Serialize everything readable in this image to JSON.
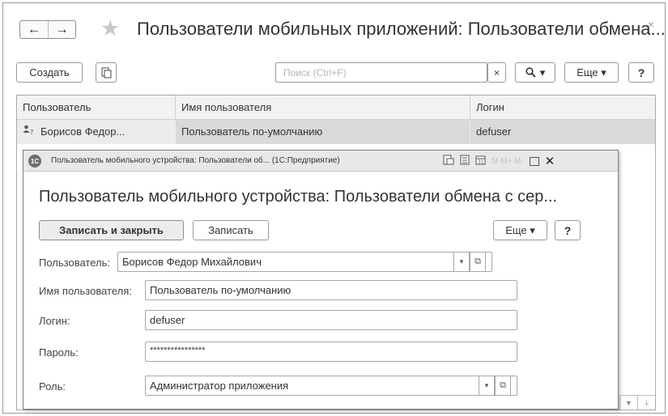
{
  "window": {
    "title": "Пользователи мобильных приложений: Пользователи обмена...",
    "close_glyph": "×"
  },
  "nav": {
    "back_glyph": "←",
    "forward_glyph": "→",
    "favorite_glyph": "★"
  },
  "toolbar": {
    "create_label": "Создать",
    "search_placeholder": "Поиск (Ctrl+F)",
    "clear_glyph": "×",
    "find_glyph": "🔍 ▾",
    "more_label": "Еще ▾",
    "help_label": "?"
  },
  "table": {
    "columns": [
      "Пользователь",
      "Имя пользователя",
      "Логин"
    ],
    "rows": [
      {
        "user": "Борисов Федор...",
        "name": "Пользователь по-умолчанию",
        "login": "defuser"
      }
    ]
  },
  "dialog": {
    "window_title": "Пользователь мобильного устройства: Пользователи об... (1С:Предприятие)",
    "logo_text": "1С",
    "toolbar_dim": "M  M+  M-",
    "heading": "Пользователь мобильного устройства: Пользователи обмена с сер...",
    "save_close_label": "Записать и закрыть",
    "save_label": "Записать",
    "more_label": "Еще ▾",
    "help_label": "?",
    "fields": {
      "user": {
        "label": "Пользователь:",
        "value": "Борисов Федор Михайлович"
      },
      "name": {
        "label": "Имя пользователя:",
        "value": "Пользователь по-умолчанию"
      },
      "login": {
        "label": "Логин:",
        "value": "defuser"
      },
      "password": {
        "label": "Пароль:",
        "value": "****************"
      },
      "role": {
        "label": "Роль:",
        "value": "Администратор приложения"
      }
    }
  },
  "icons": {
    "dropdown": "▾",
    "open": "⧉",
    "user_row": "👤?"
  },
  "colors": {
    "selected_row": "#d9d9d9",
    "default_button": "#ececec",
    "titlebar": "#e8e8e8"
  }
}
